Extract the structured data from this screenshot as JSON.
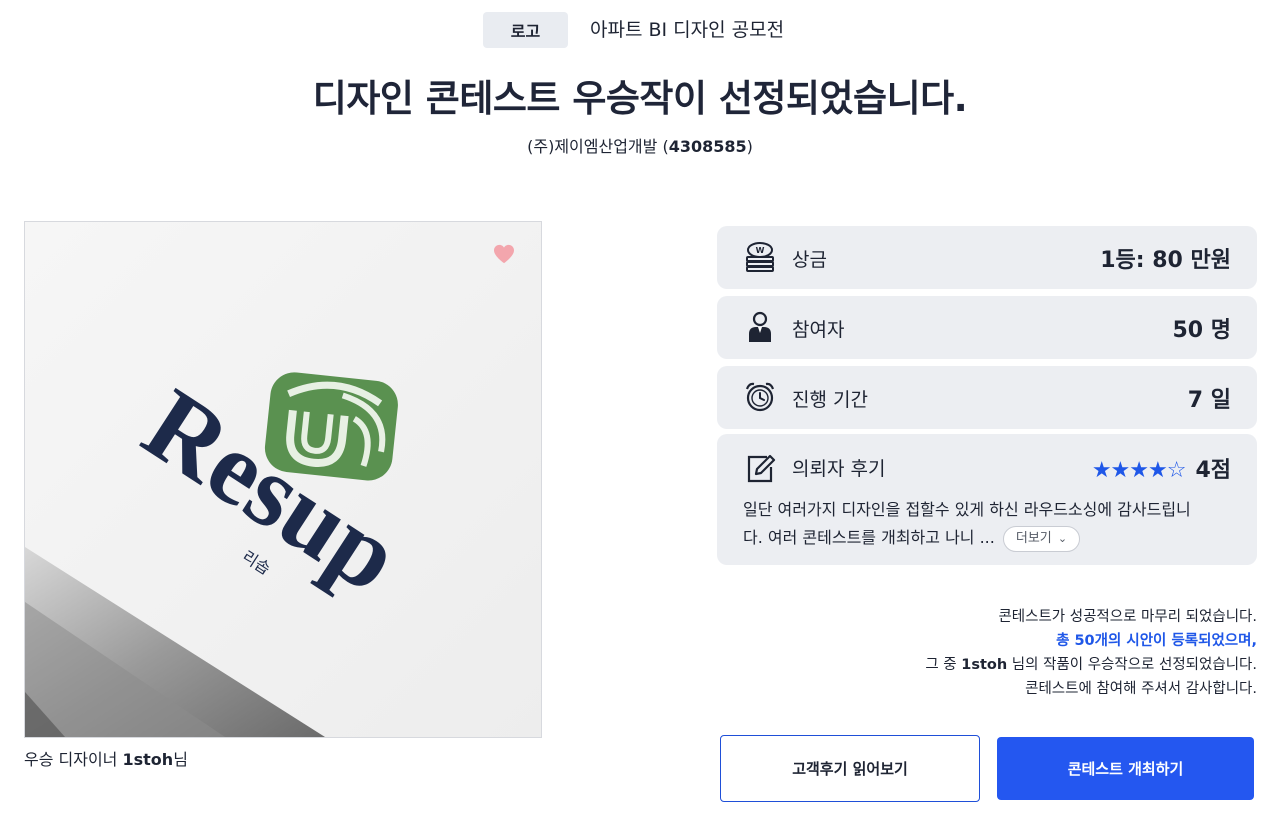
{
  "header": {
    "category_badge": "로고",
    "contest_name": "아파트 BI 디자인 공모전",
    "headline": "디자인 콘테스트 우승작이 선정되었습니다.",
    "company_name": "(주)제이엠산업개발",
    "contest_id": "4308585"
  },
  "winner": {
    "logo_wordmark": "Resup",
    "logo_subtitle": "리솝",
    "caption_prefix": "우승 디자이너 ",
    "designer_name": "1stoh",
    "caption_suffix": "님"
  },
  "stats": {
    "prize": {
      "icon": "money-stack-icon",
      "label": "상금",
      "value": "1등: 80 만원"
    },
    "participants": {
      "icon": "person-icon",
      "label": "참여자",
      "value": "50 명"
    },
    "duration": {
      "icon": "alarm-clock-icon",
      "label": "진행 기간",
      "value": "7 일"
    },
    "review": {
      "icon": "edit-icon",
      "label": "의뢰자 후기",
      "stars_text": "★★★★☆",
      "stars_value": 4,
      "score": "4점",
      "text_line1": "일단 여러가지 디자인을 접할수 있게 하신 라우드소싱에 감사드립니",
      "text_line2": "다. 여러 콘테스트를 개최하고 나니 ...",
      "more_label": "더보기"
    }
  },
  "summary": {
    "line1": "콘테스트가 성공적으로 마무리 되었습니다.",
    "line2": "총 50개의 시안이 등록되었으며,",
    "line3_prefix": "그 중 ",
    "line3_name": "1stoh",
    "line3_suffix": " 님의 작품이 우승작으로 선정되었습니다.",
    "line4": "콘테스트에 참여해 주셔서 감사합니다."
  },
  "buttons": {
    "review_label": "고객후기 읽어보기",
    "host_label": "콘테스트 개최하기"
  },
  "colors": {
    "accent_blue": "#2457f0",
    "card_bg": "#eceef2",
    "logo_green": "#5a9150",
    "logo_navy": "#1d2a4a",
    "heart_pink": "#f3a6ad"
  }
}
